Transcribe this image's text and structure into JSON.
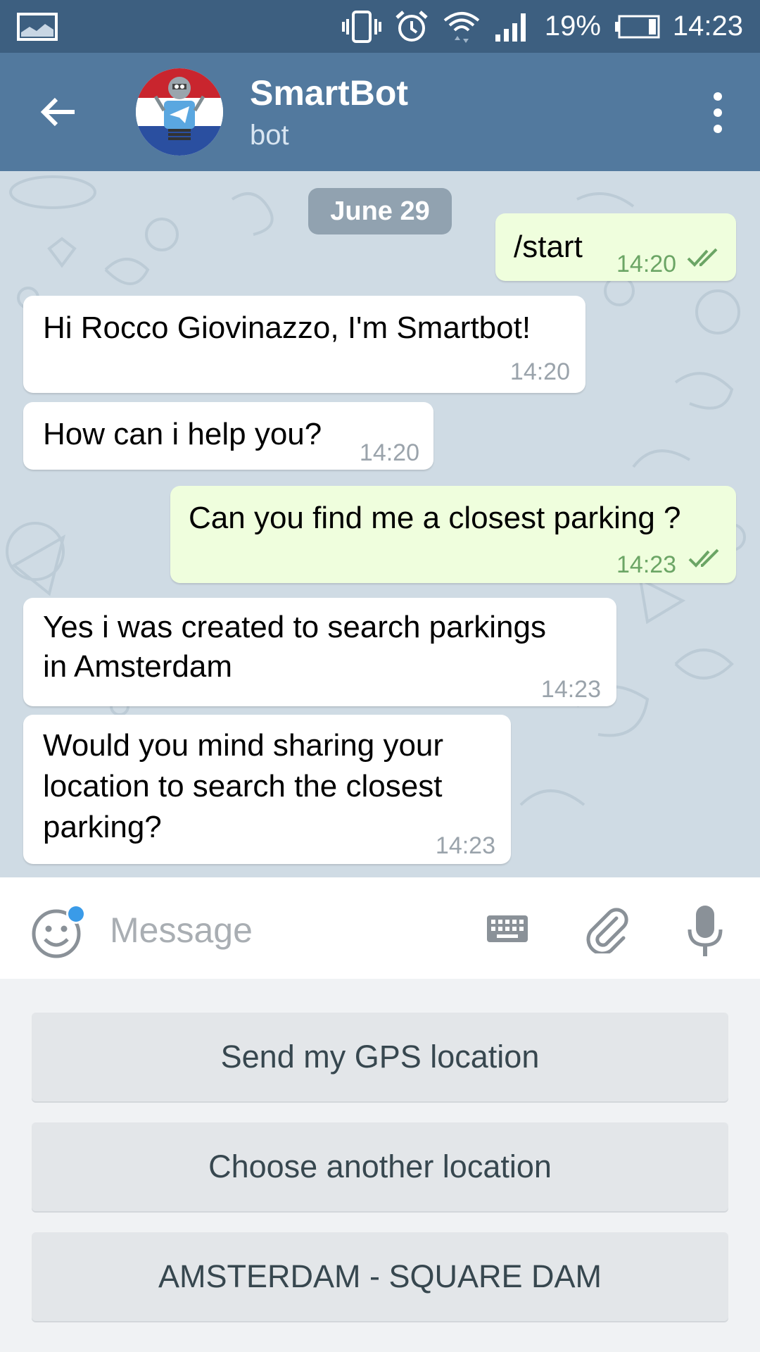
{
  "status_bar": {
    "battery": "19%",
    "time": "14:23"
  },
  "header": {
    "title": "SmartBot",
    "subtitle": "bot",
    "avatar_text": "Telegram"
  },
  "chat": {
    "date": "June 29",
    "messages": [
      {
        "direction": "out",
        "text": "/start",
        "time": "14:20",
        "read": true
      },
      {
        "direction": "in",
        "text": "Hi Rocco Giovinazzo, I'm Smartbot!",
        "time": "14:20"
      },
      {
        "direction": "in",
        "text": "How can i help you?",
        "time": "14:20"
      },
      {
        "direction": "out",
        "text": "Can you find me a closest parking ?",
        "time": "14:23",
        "read": true
      },
      {
        "direction": "in",
        "lines": [
          "Yes i was created to search parkings",
          "in Amsterdam"
        ],
        "time": "14:23"
      },
      {
        "direction": "in",
        "lines": [
          "Would you mind sharing your",
          "location to search the closest",
          "parking?"
        ],
        "time": "14:23"
      }
    ]
  },
  "input": {
    "placeholder": "Message"
  },
  "reply_keyboard": {
    "buttons": [
      "Send my GPS location",
      "Choose another location",
      "AMSTERDAM - SQUARE DAM"
    ]
  },
  "colors": {
    "status_bar": "#3d5f80",
    "header": "#52799e",
    "chat_background": "#cfdbe4",
    "outgoing_bubble": "#effedd",
    "incoming_bubble": "#ffffff",
    "read_tick": "#6ba565",
    "notification_dot": "#3a9be8"
  },
  "icons": {
    "back": "arrow-left-icon",
    "menu": "more-vertical-icon",
    "emoji": "smiley-icon",
    "keyboard": "keyboard-icon",
    "attach": "paperclip-icon",
    "mic": "microphone-icon",
    "read": "double-check-icon"
  }
}
